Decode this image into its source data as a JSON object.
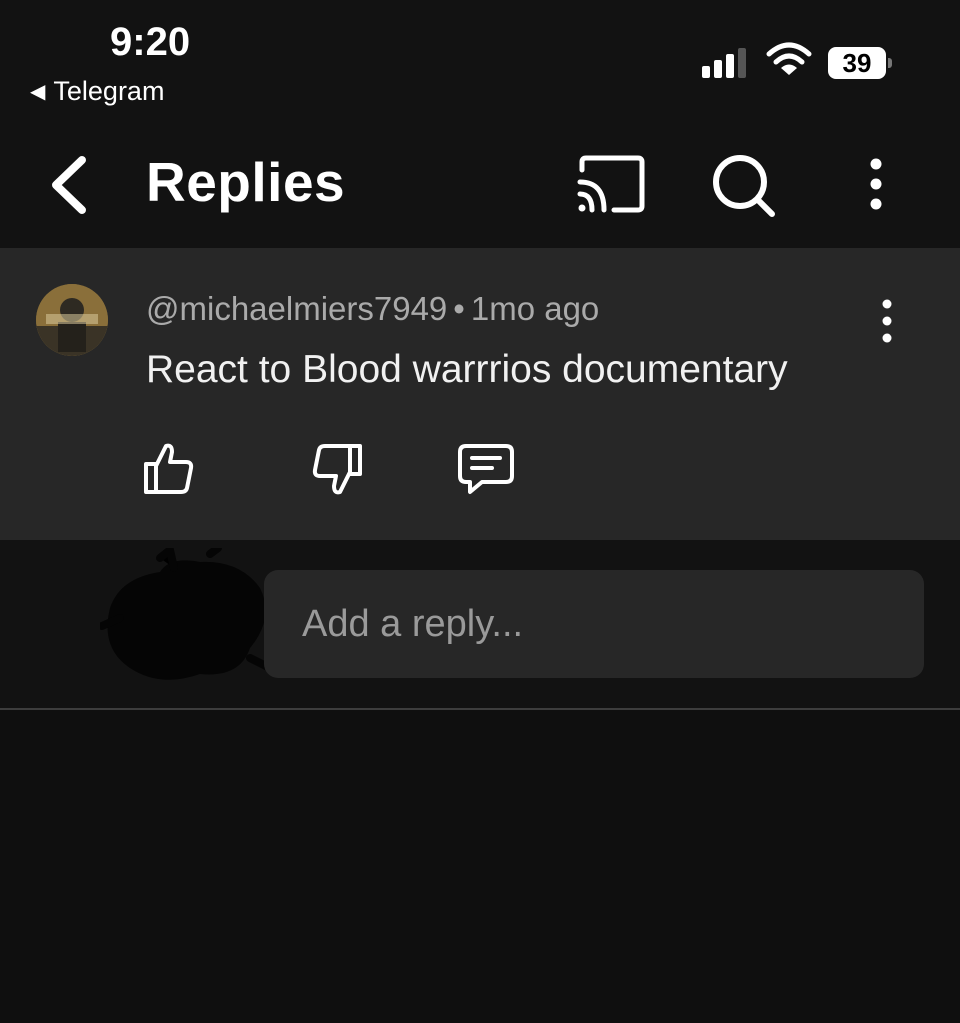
{
  "status_bar": {
    "time": "9:20",
    "back_app": "Telegram",
    "battery": "39",
    "signal_bars": 3,
    "signal_bars_total": 4
  },
  "header": {
    "title": "Replies",
    "icons": [
      "back-arrow-icon",
      "cast-icon",
      "search-icon",
      "more-vertical-icon"
    ]
  },
  "comment": {
    "author": "@michaelmiers7949",
    "separator": "•",
    "age": "1mo ago",
    "text": "React to Blood warrrios documentary",
    "actions": [
      "like-icon",
      "dislike-icon",
      "reply-icon"
    ]
  },
  "reply_box": {
    "placeholder": "Add a reply..."
  },
  "colors": {
    "background": "#0f0f0f",
    "header": "#121212",
    "comment_background": "#272727",
    "secondary_text": "#aaaaaa"
  }
}
